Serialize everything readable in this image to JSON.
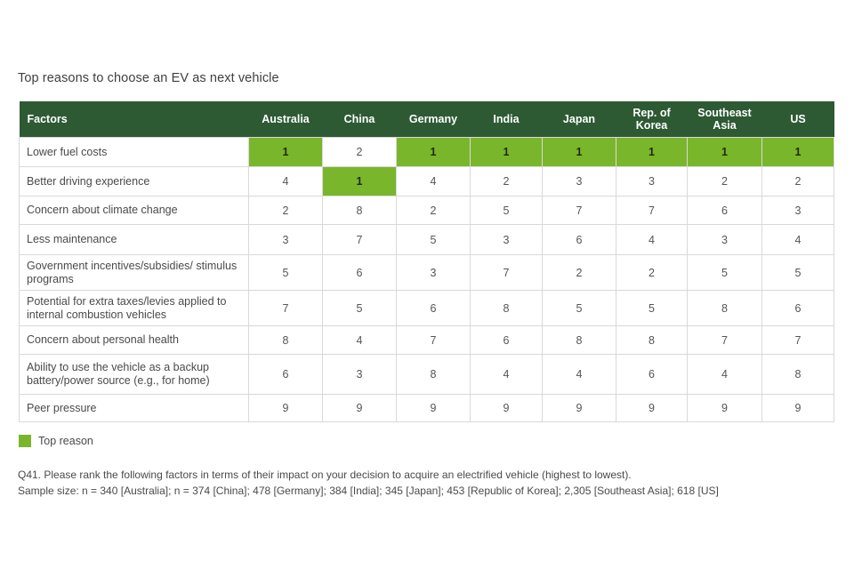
{
  "title": "Top reasons to choose an EV as next vehicle",
  "colors": {
    "header_bg": "#2d5a33",
    "top_reason": "#7ab62c"
  },
  "legend_label": "Top reason",
  "question": "Q41. Please rank the following factors in terms of their impact on your decision to acquire an electrified vehicle (highest to lowest).",
  "sample_size": "Sample size: n = 340 [Australia]; n = 374 [China]; 478 [Germany]; 384 [India]; 345 [Japan]; 453 [Republic of Korea]; 2,305 [Southeast Asia]; 618 [US]",
  "chart_data": {
    "type": "table",
    "title": "Top reasons to choose an EV as next vehicle",
    "header_first": "Factors",
    "columns": [
      "Australia",
      "China",
      "Germany",
      "India",
      "Japan",
      "Rep. of Korea",
      "Southeast Asia",
      "US"
    ],
    "rows": [
      {
        "factor": "Lower fuel costs",
        "values": [
          1,
          2,
          1,
          1,
          1,
          1,
          1,
          1
        ]
      },
      {
        "factor": "Better driving experience",
        "values": [
          4,
          1,
          4,
          2,
          3,
          3,
          2,
          2
        ]
      },
      {
        "factor": "Concern about climate change",
        "values": [
          2,
          8,
          2,
          5,
          7,
          7,
          6,
          3
        ]
      },
      {
        "factor": "Less maintenance",
        "values": [
          3,
          7,
          5,
          3,
          6,
          4,
          3,
          4
        ]
      },
      {
        "factor": "Government incentives/subsidies/ stimulus programs",
        "values": [
          5,
          6,
          3,
          7,
          2,
          2,
          5,
          5
        ]
      },
      {
        "factor": "Potential for extra taxes/levies applied to internal combustion vehicles",
        "values": [
          7,
          5,
          6,
          8,
          5,
          5,
          8,
          6
        ]
      },
      {
        "factor": "Concern about personal health",
        "values": [
          8,
          4,
          7,
          6,
          8,
          8,
          7,
          7
        ]
      },
      {
        "factor": "Ability to use the vehicle as a backup battery/power source (e.g., for home)",
        "values": [
          6,
          3,
          8,
          4,
          4,
          6,
          4,
          8
        ]
      },
      {
        "factor": "Peer pressure",
        "values": [
          9,
          9,
          9,
          9,
          9,
          9,
          9,
          9
        ]
      }
    ],
    "highlight_rule": "rank 1 = Top reason"
  }
}
